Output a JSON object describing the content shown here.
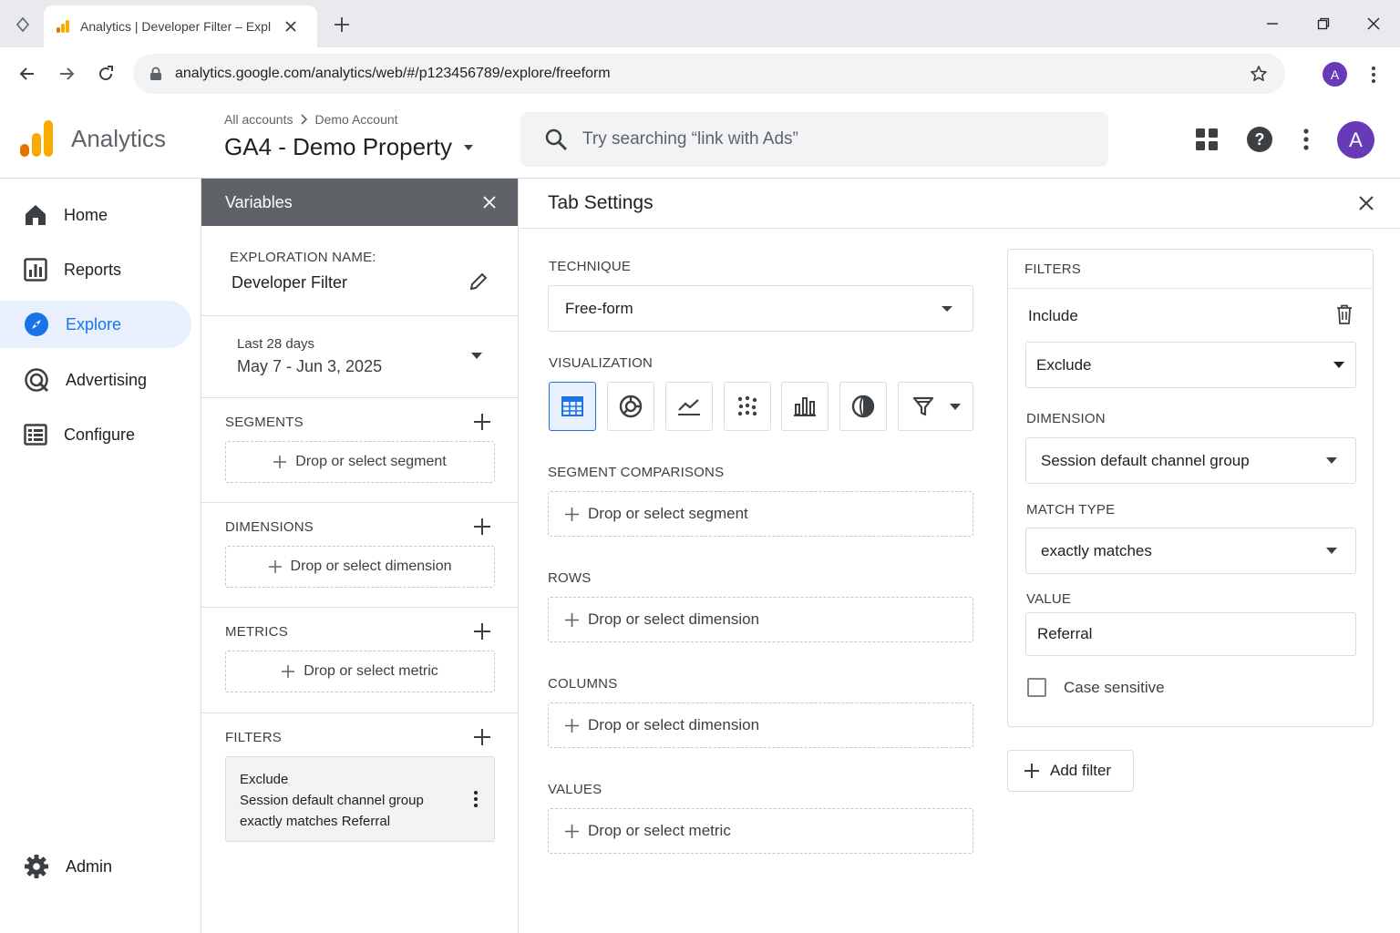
{
  "browser": {
    "tab_title": "Analytics | Developer Filter – Expl",
    "url": "analytics.google.com/analytics/web/#/p123456789/explore/freeform",
    "profile_initial": "A"
  },
  "header": {
    "app_name": "Analytics",
    "breadcrumb_root": "All accounts",
    "breadcrumb_account": "Demo Account",
    "property": "GA4 - Demo Property",
    "search_placeholder": "Try searching “link with Ads”",
    "avatar_initial": "A"
  },
  "nav": {
    "items": [
      {
        "label": "Home",
        "icon": "home-icon"
      },
      {
        "label": "Reports",
        "icon": "reports-icon"
      },
      {
        "label": "Explore",
        "icon": "explore-icon",
        "active": true
      },
      {
        "label": "Advertising",
        "icon": "advertising-icon"
      },
      {
        "label": "Configure",
        "icon": "configure-icon"
      }
    ],
    "admin": "Admin"
  },
  "variables": {
    "title": "Variables",
    "exploration_label": "EXPLORATION NAME:",
    "exploration_name": "Developer Filter",
    "date_range_label": "Last 28 days",
    "date_range": "May 7 - Jun 3, 2025",
    "segments": {
      "title": "SEGMENTS",
      "drop": "Drop or select segment"
    },
    "dimensions": {
      "title": "DIMENSIONS",
      "drop": "Drop or select dimension"
    },
    "metrics": {
      "title": "METRICS",
      "drop": "Drop or select metric"
    },
    "filters": {
      "title": "FILTERS",
      "chip_line1": "Exclude",
      "chip_line2": "Session default channel group",
      "chip_line3": "exactly matches Referral"
    }
  },
  "tab_settings": {
    "title": "Tab Settings",
    "technique_label": "TECHNIQUE",
    "technique_value": "Free-form",
    "visualization_label": "VISUALIZATION",
    "visualizations": [
      "table-icon",
      "donut-icon",
      "line-chart-icon",
      "scatter-icon",
      "bar-chart-icon",
      "geo-map-icon",
      "funnel-icon"
    ],
    "segment_comparisons_label": "SEGMENT COMPARISONS",
    "segment_comparisons_drop": "Drop or select segment",
    "rows_label": "ROWS",
    "rows_drop": "Drop or select dimension",
    "columns_label": "COLUMNS",
    "columns_drop": "Drop or select dimension",
    "values_label": "VALUES",
    "values_drop": "Drop or select metric"
  },
  "filter_editor": {
    "title": "FILTERS",
    "include_label": "Include",
    "mode_value": "Exclude",
    "dimension_label": "DIMENSION",
    "dimension_value": "Session default channel group",
    "match_type_label": "MATCH TYPE",
    "match_type_value": "exactly matches",
    "value_label": "VALUE",
    "value": "Referral",
    "case_sensitive_label": "Case sensitive",
    "case_sensitive_checked": false,
    "add_filter_label": "Add filter"
  },
  "colors": {
    "accent": "#1a73e8",
    "panel_header": "#5f6368",
    "active_nav_bg": "#e8f0fe",
    "avatar": "#673ab7",
    "logo_orange": "#f9ab00",
    "logo_dark_orange": "#e37400"
  }
}
